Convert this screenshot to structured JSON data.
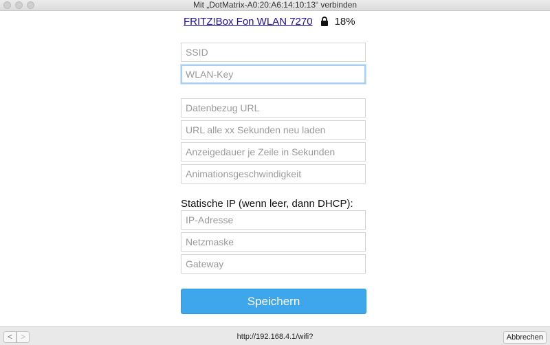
{
  "window": {
    "title": "Mit „DotMatrix-A0:20:A6:14:10:13“ verbinden"
  },
  "header": {
    "network_link": "FRITZ!Box Fon WLAN 7270",
    "signal": "18%"
  },
  "fields": {
    "ssid": "SSID",
    "wlan_key": "WLAN-Key",
    "data_url": "Datenbezug URL",
    "reload_interval": "URL alle xx Sekunden neu laden",
    "line_display_duration": "Anzeigedauer je Zeile in Sekunden",
    "animation_speed": "Animationsgeschwindigkeit"
  },
  "static_ip": {
    "label": "Statische IP (wenn leer, dann DHCP):",
    "ip_address": "IP-Adresse",
    "netmask": "Netzmaske",
    "gateway": "Gateway"
  },
  "save_label": "Speichern",
  "bottom": {
    "back": "<",
    "forward": ">",
    "url": "http://192.168.4.1/wifi?",
    "cancel_label": "Abbrechen"
  }
}
